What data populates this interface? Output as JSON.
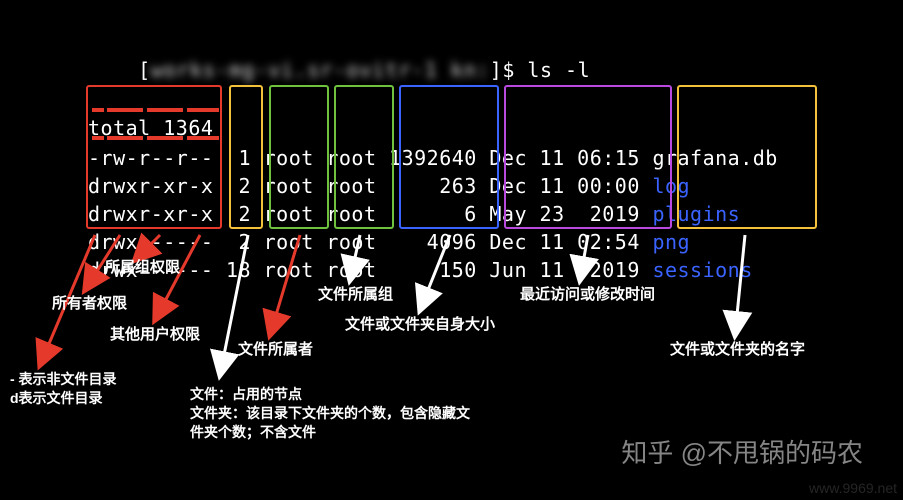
{
  "prompt": {
    "open_bracket": "[",
    "obscured_host": "works-mg-vi.sr-ovitr-1 kn:",
    "close": "]$ ",
    "command": "ls -l"
  },
  "total_line": "total 1364",
  "rows": [
    {
      "perm": "-rw-r--r--",
      "links": "1",
      "owner": "root",
      "group": "root",
      "size": "1392640",
      "date": "Dec 11 06:15",
      "name": "grafana.db",
      "dir": false
    },
    {
      "perm": "drwxr-xr-x",
      "links": "2",
      "owner": "root",
      "group": "root",
      "size": "263",
      "date": "Dec 11 00:00",
      "name": "log",
      "dir": true
    },
    {
      "perm": "drwxr-xr-x",
      "links": "2",
      "owner": "root",
      "group": "root",
      "size": "6",
      "date": "May 23  2019",
      "name": "plugins",
      "dir": true
    },
    {
      "perm": "drwx------",
      "links": "2",
      "owner": "root",
      "group": "root",
      "size": "4096",
      "date": "Dec 11 02:54",
      "name": "png",
      "dir": true
    },
    {
      "perm": "drwx------",
      "links": "18",
      "owner": "root",
      "group": "root",
      "size": "150",
      "date": "Jun 11  2019",
      "name": "sessions",
      "dir": true
    }
  ],
  "labels": {
    "file_type": "- 表示非文件目录\nd表示文件目录",
    "owner_perm": "所有者权限",
    "group_perm": "所属组权限",
    "other_perm": "其他用户权限",
    "links": "文件：占用的节点\n文件夹：该目录下文件夹的个数，包含隐藏文\n件夹个数；不含文件",
    "owner": "文件所属者",
    "group": "文件所属组",
    "size": "文件或文件夹自身大小",
    "date": "最近访问或修改时间",
    "name": "文件或文件夹的名字"
  },
  "watermark": {
    "author": "知乎 @不甩锅的码农",
    "site": "www.9969.net"
  }
}
